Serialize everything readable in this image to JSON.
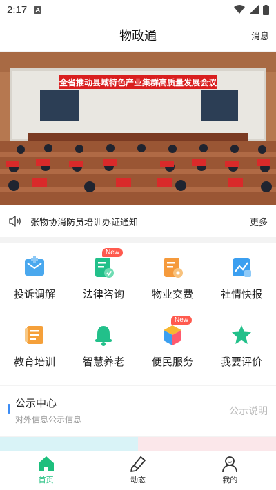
{
  "status_bar": {
    "time": "2:17",
    "notif_letter": "A"
  },
  "header": {
    "title": "物政通",
    "messages_label": "消息"
  },
  "banner": {
    "headline": "全省推动县域特色产业集群高质量发展会议"
  },
  "notice_bar": {
    "text": "张物协消防员培训办证通知",
    "more_label": "更多"
  },
  "services": [
    {
      "label": "投诉调解",
      "icon": "complaint-icon",
      "badge": ""
    },
    {
      "label": "法律咨询",
      "icon": "legal-icon",
      "badge": "New"
    },
    {
      "label": "物业交费",
      "icon": "payment-icon",
      "badge": ""
    },
    {
      "label": "社情快报",
      "icon": "report-icon",
      "badge": ""
    },
    {
      "label": "教育培训",
      "icon": "education-icon",
      "badge": ""
    },
    {
      "label": "智慧养老",
      "icon": "bell-icon",
      "badge": ""
    },
    {
      "label": "便民服务",
      "icon": "cube-icon",
      "badge": "New"
    },
    {
      "label": "我要评价",
      "icon": "star-icon",
      "badge": ""
    }
  ],
  "public_center": {
    "title": "公示中心",
    "subtitle": "对外信息公示信息",
    "link_label": "公示说明"
  },
  "tabs": [
    {
      "label": "首页",
      "icon": "home-icon",
      "active": true
    },
    {
      "label": "动态",
      "icon": "pen-icon",
      "active": false
    },
    {
      "label": "我的",
      "icon": "user-icon",
      "active": false
    }
  ],
  "colors": {
    "accent": "#1dbf7d",
    "badge": "#ff5a4e",
    "marker": "#3b8cf5"
  }
}
